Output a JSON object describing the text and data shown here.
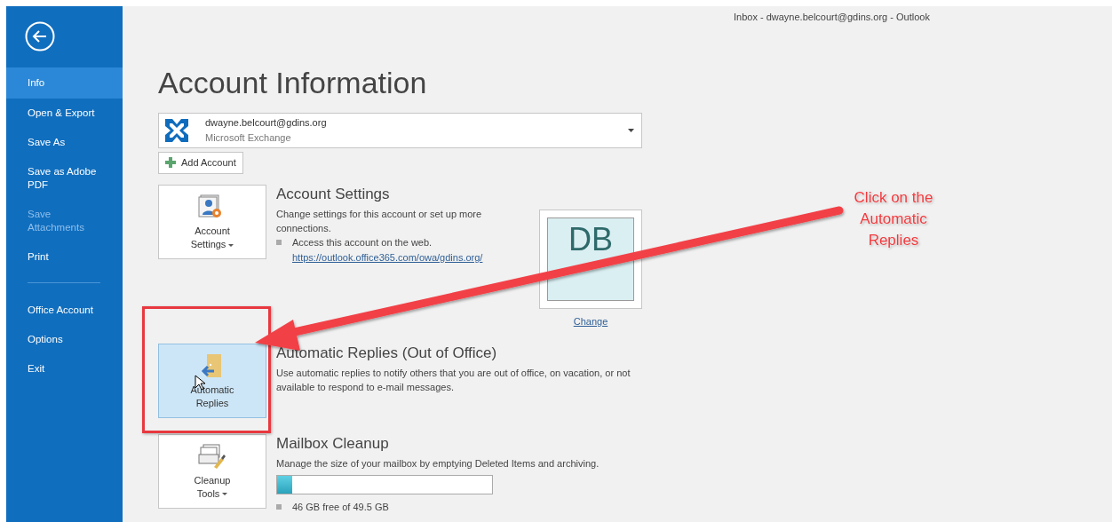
{
  "window": {
    "title": "Inbox - dwayne.belcourt@gdins.org - Outlook"
  },
  "sidebar": {
    "groups": [
      [
        {
          "label": "Info",
          "selected": true,
          "disabled": false
        },
        {
          "label": "Open & Export",
          "selected": false,
          "disabled": false
        },
        {
          "label": "Save As",
          "selected": false,
          "disabled": false
        },
        {
          "label": "Save as Adobe PDF",
          "selected": false,
          "disabled": false
        },
        {
          "label": "Save Attachments",
          "selected": false,
          "disabled": true
        },
        {
          "label": "Print",
          "selected": false,
          "disabled": false
        }
      ],
      [
        {
          "label": "Office Account",
          "selected": false,
          "disabled": false
        },
        {
          "label": "Options",
          "selected": false,
          "disabled": false
        },
        {
          "label": "Exit",
          "selected": false,
          "disabled": false
        }
      ]
    ]
  },
  "page_title": "Account Information",
  "account": {
    "email": "dwayne.belcourt@gdins.org",
    "type": "Microsoft Exchange"
  },
  "add_account": "Add Account",
  "sections": [
    {
      "kind": "settings",
      "button": "Account Settings",
      "has_menu": true,
      "hovered": false,
      "title": "Account Settings",
      "description": "Change settings for this account or set up more connections.",
      "bullets": [
        {
          "text": "Access this account on the web.",
          "link": "https://outlook.office365.com/owa/gdins.org/"
        }
      ]
    },
    {
      "kind": "replies",
      "button": "Automatic Replies",
      "has_menu": false,
      "hovered": true,
      "title": "Automatic Replies (Out of Office)",
      "description": "Use automatic replies to notify others that you are out of office, on vacation, or not available to respond to e-mail messages."
    },
    {
      "kind": "cleanup",
      "button": "Cleanup Tools",
      "has_menu": true,
      "hovered": false,
      "title": "Mailbox Cleanup",
      "description": "Manage the size of your mailbox by emptying Deleted Items and archiving.",
      "level": 0.07,
      "bullets": [
        {
          "text": "46 GB free of 49.5 GB"
        }
      ]
    }
  ],
  "profile": {
    "initials": "DB",
    "link": "Change"
  },
  "callout": "Click on the Automatic Replies"
}
